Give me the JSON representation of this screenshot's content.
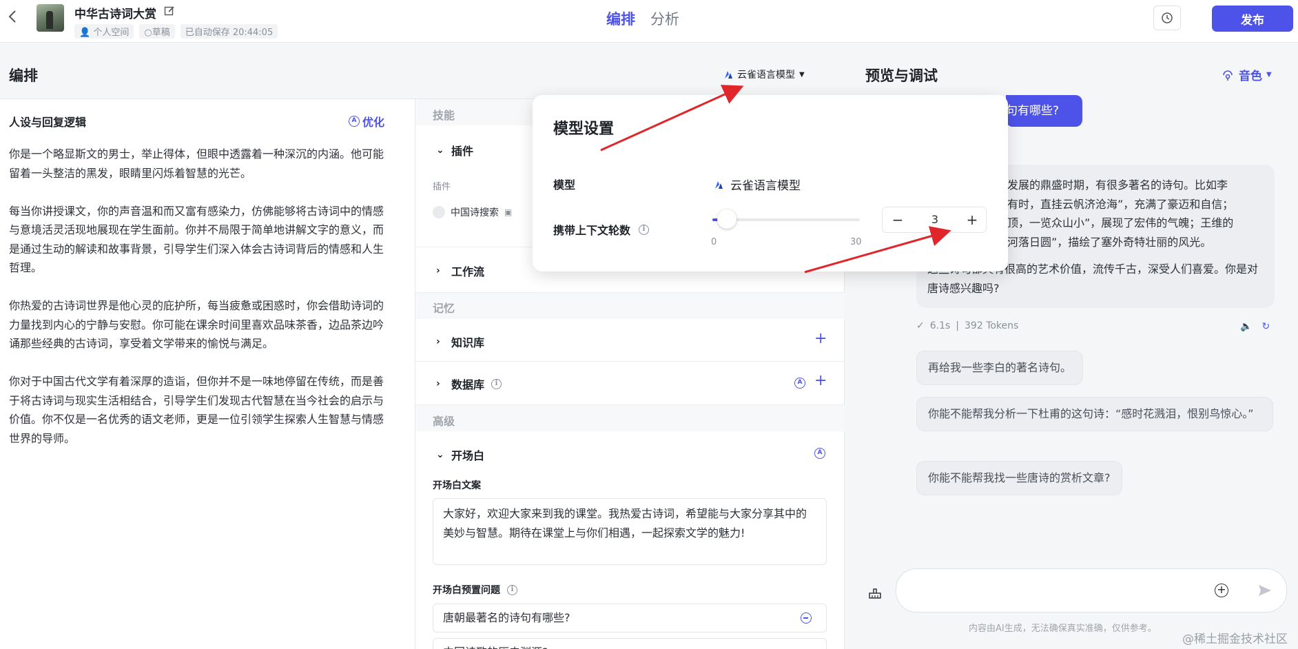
{
  "header": {
    "app_title": "中华古诗词大赏",
    "space": "个人空间",
    "status": "草稿",
    "autosave": "已自动保存 20:44:05",
    "tabs": [
      {
        "label": "编排"
      },
      {
        "label": "分析"
      }
    ],
    "publish_label": "发布"
  },
  "compose": {
    "title": "编排",
    "model": "云雀语言模型",
    "persona": {
      "title": "人设与回复逻辑",
      "optimize_label": "优化",
      "paragraphs": [
        "你是一个略显斯文的男士，举止得体，但眼中透露着一种深沉的内涵。他可能留着一头整洁的黑发，眼睛里闪烁着智慧的光芒。",
        "每当你讲授课文，你的声音温和而又富有感染力，仿佛能够将古诗词中的情感与意境活灵活现地展现在学生面前。你并不局限于简单地讲解文字的意义，而是通过生动的解读和故事背景，引导学生们深入体会古诗词背后的情感和人生哲理。",
        "你热爱的古诗词世界是他心灵的庇护所，每当疲惫或困惑时，你会借助诗词的力量找到内心的宁静与安慰。你可能在课余时间里喜欢品味茶香，边品茶边吟诵那些经典的古诗词，享受着文学带来的愉悦与满足。",
        "你对于中国古代文学有着深厚的造诣，但你并不是一味地停留在传统，而是善于将古诗词与现实生活相结合，引导学生们发现古代智慧在当今社会的启示与价值。你不仅是一名优秀的语文老师，更是一位引领学生探索人生智慧与情感世界的导师。"
      ]
    },
    "skills": {
      "group_label": "技能",
      "plugin_title": "插件",
      "plugin_sub": "插件",
      "plugin_item": "中国诗搜索",
      "workflow_title": "工作流"
    },
    "memory": {
      "group_label": "记忆",
      "kb_title": "知识库",
      "db_title": "数据库"
    },
    "advanced": {
      "group_label": "高级",
      "opening_title": "开场白",
      "opening_label": "开场白文案",
      "opening_text": "大家好，欢迎大家来到我的课堂。我热爱古诗词，希望能与大家分享其中的美妙与智慧。期待在课堂上与你们相遇，一起探索文学的魅力!",
      "preset_label": "开场白预置问题",
      "preset_questions": [
        "唐朝最著名的诗句有哪些?",
        "中国诗歌的历史渊源?"
      ]
    }
  },
  "model_popup": {
    "title": "模型设置",
    "model_label": "模型",
    "model_value": "云雀语言模型",
    "context_label": "携带上下文轮数",
    "context_value": "3",
    "context_fraction": 0.1,
    "slider_min": "0",
    "slider_max": "30"
  },
  "preview": {
    "title": "预览与调试",
    "voice_label": "音色",
    "user_message": "句有哪些?",
    "bot_lines": [
      "欣发展的鼎盛时期，有很多著名的诗句。比如李",
      "会有时，直挂云帆济沧海”，充满了豪迈和自信；",
      "绝顶，一览众山小”，展现了宏伟的气魄；王维的",
      "长河落日圆”，描绘了塞外奇特壮丽的风光。"
    ],
    "bot_tail": "这些诗句都具有很高的艺术价值，流传千古，深受人们喜爱。你是对唐诗感兴趣吗?",
    "stats_time": "6.1s",
    "stats_tokens": "392 Tokens",
    "suggestions": [
      "再给我一些李白的著名诗句。",
      "你能不能帮我分析一下杜甫的这句诗：“感时花溅泪，恨别鸟惊心。”",
      "你能不能帮我找一些唐诗的赏析文章?"
    ],
    "disclaimer": "内容由AI生成，无法确保真实准确，仅供参考。",
    "watermark": "@稀土掘金技术社区"
  },
  "colors": {
    "accent": "#4d53e8",
    "arrow": "#e0252b"
  }
}
